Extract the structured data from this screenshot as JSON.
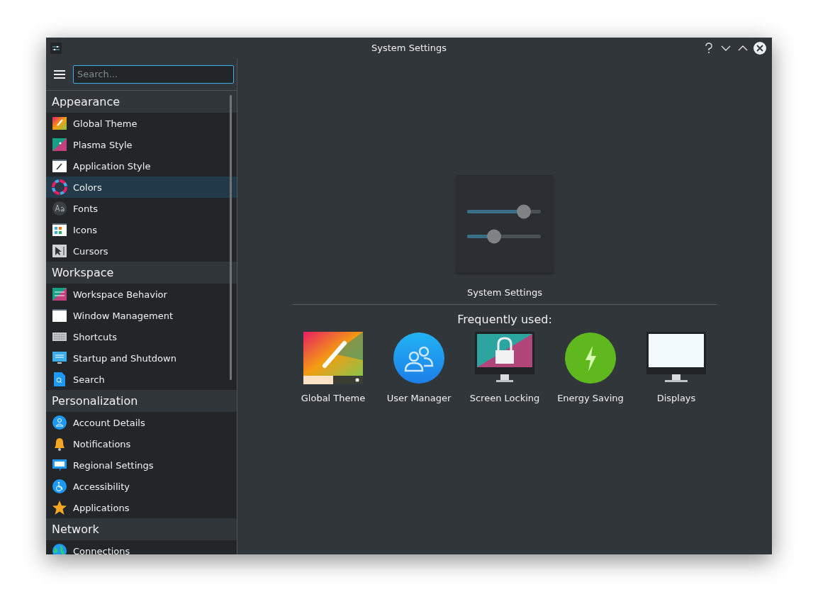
{
  "window": {
    "title": "System Settings"
  },
  "search": {
    "placeholder": "Search..."
  },
  "sidebar": {
    "sections": [
      {
        "title": "Appearance",
        "items": [
          {
            "label": "Global Theme",
            "selected": false
          },
          {
            "label": "Plasma Style",
            "selected": false
          },
          {
            "label": "Application Style",
            "selected": false
          },
          {
            "label": "Colors",
            "selected": true
          },
          {
            "label": "Fonts",
            "selected": false
          },
          {
            "label": "Icons",
            "selected": false
          },
          {
            "label": "Cursors",
            "selected": false
          }
        ]
      },
      {
        "title": "Workspace",
        "items": [
          {
            "label": "Workspace Behavior",
            "selected": false
          },
          {
            "label": "Window Management",
            "selected": false
          },
          {
            "label": "Shortcuts",
            "selected": false
          },
          {
            "label": "Startup and Shutdown",
            "selected": false
          },
          {
            "label": "Search",
            "selected": false
          }
        ]
      },
      {
        "title": "Personalization",
        "items": [
          {
            "label": "Account Details",
            "selected": false
          },
          {
            "label": "Notifications",
            "selected": false
          },
          {
            "label": "Regional Settings",
            "selected": false
          },
          {
            "label": "Accessibility",
            "selected": false
          },
          {
            "label": "Applications",
            "selected": false
          }
        ]
      },
      {
        "title": "Network",
        "items": [
          {
            "label": "Connections",
            "selected": false
          }
        ]
      }
    ]
  },
  "main": {
    "caption": "System Settings",
    "frequent_title": "Frequently used:",
    "frequent": [
      {
        "label": "Global Theme"
      },
      {
        "label": "User Manager"
      },
      {
        "label": "Screen Locking"
      },
      {
        "label": "Energy Saving"
      },
      {
        "label": "Displays"
      }
    ]
  }
}
